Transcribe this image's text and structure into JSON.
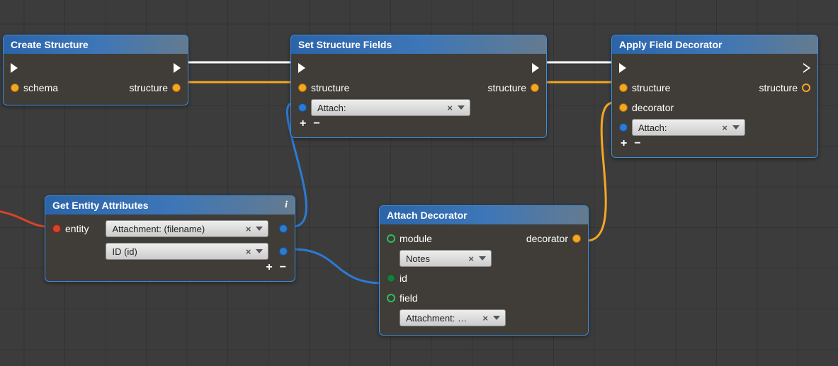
{
  "nodes": {
    "create": {
      "title": "Create Structure",
      "in_schema": "schema",
      "out_struct": "structure"
    },
    "setfields": {
      "title": "Set Structure Fields",
      "in_struct": "structure",
      "out_struct": "structure",
      "attach": "Attach:",
      "add": "+",
      "rem": "−"
    },
    "applydec": {
      "title": "Apply Field Decorator",
      "in_struct": "structure",
      "in_dec": "decorator",
      "out_struct": "structure",
      "attach": "Attach:",
      "add": "+",
      "rem": "−"
    },
    "getattr": {
      "title": "Get Entity Attributes",
      "info": "i",
      "in_entity": "entity",
      "pill1": "Attachment: (filename)",
      "pill2": "ID (id)",
      "add": "+",
      "rem": "−"
    },
    "attachdec": {
      "title": "Attach Decorator",
      "module": "module",
      "module_val": "Notes",
      "id": "id",
      "field": "field",
      "field_val": "Attachment: …",
      "out_dec": "decorator"
    }
  },
  "ui": {
    "clear": "×"
  }
}
